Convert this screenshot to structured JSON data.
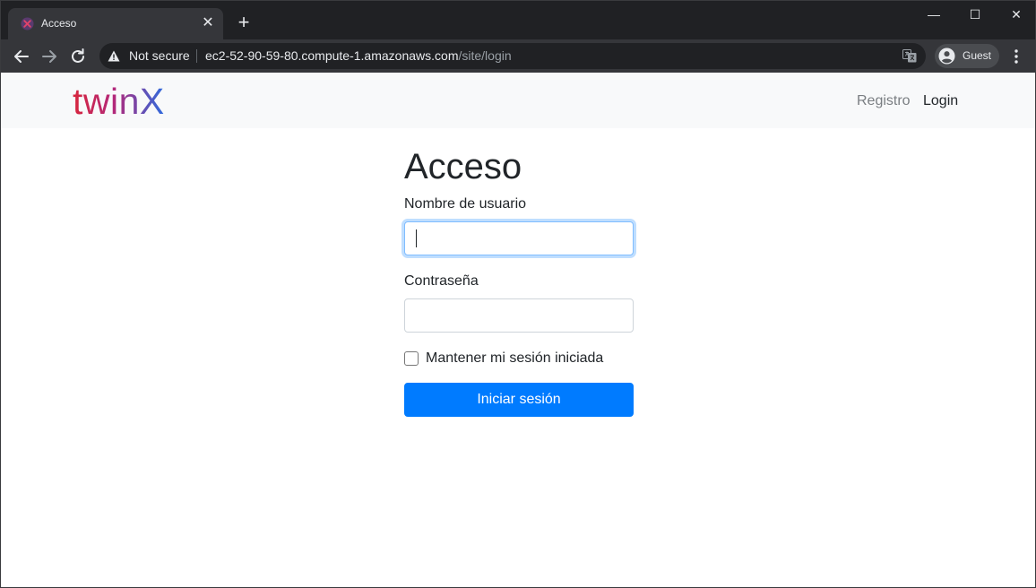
{
  "browser": {
    "tab": {
      "title": "Acceso",
      "favicon": "twinx-favicon-icon"
    },
    "new_tab_symbol": "+",
    "window_controls": {
      "minimize": "—",
      "maximize": "☐",
      "close": "✕"
    },
    "address_bar": {
      "security_label": "Not secure",
      "url_host": "ec2-52-90-59-80.compute-1.amazonaws.com",
      "url_path": "/site/login"
    },
    "profile": {
      "label": "Guest"
    }
  },
  "navbar": {
    "brand": "twinX",
    "brand_colors": [
      "#d7263d",
      "#b3287a",
      "#2d6cdf"
    ],
    "links": [
      {
        "label": "Registro",
        "active": false
      },
      {
        "label": "Login",
        "active": true
      }
    ]
  },
  "login_form": {
    "heading": "Acceso",
    "username": {
      "label": "Nombre de usuario",
      "value": "",
      "placeholder": "",
      "focused": true
    },
    "password": {
      "label": "Contraseña",
      "value": "",
      "placeholder": ""
    },
    "remember_me": {
      "label": "Mantener mi sesión iniciada",
      "checked": false
    },
    "submit_label": "Iniciar sesión",
    "accent_color": "#007bff"
  }
}
